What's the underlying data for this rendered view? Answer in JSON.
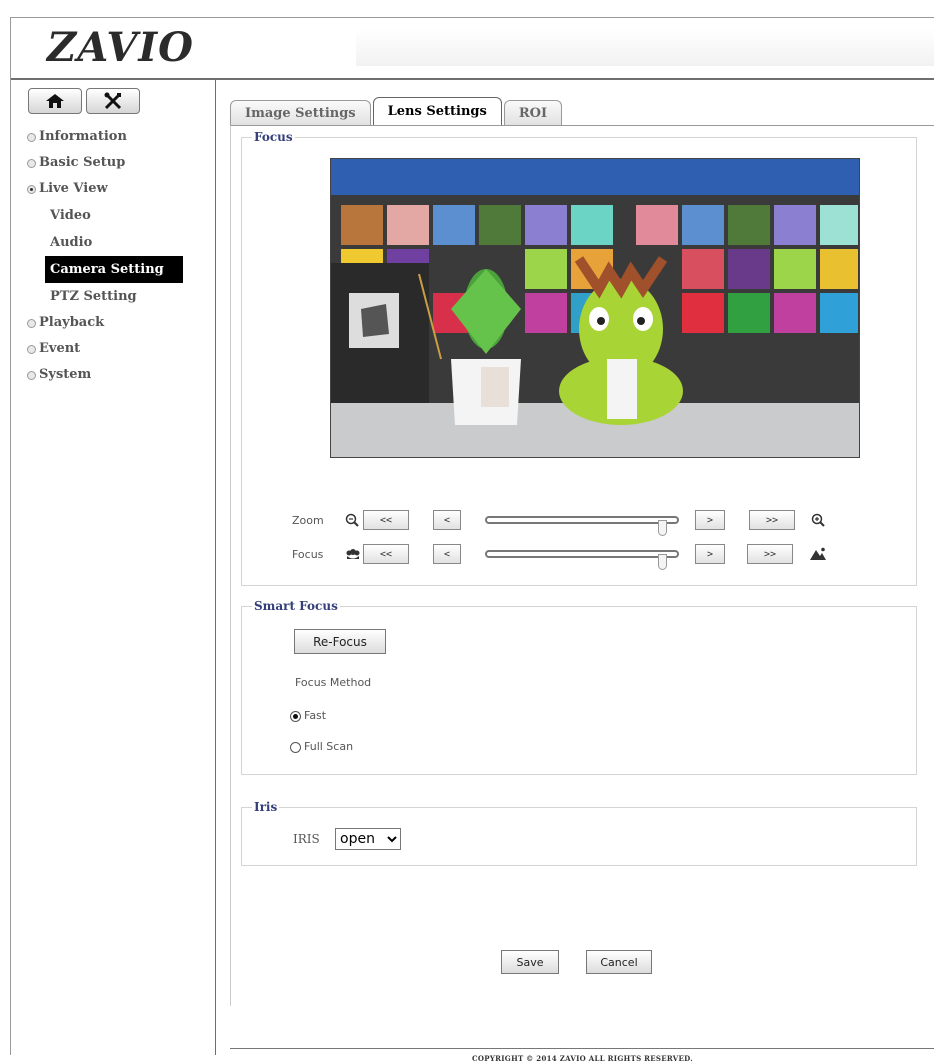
{
  "brand": {
    "logo_text": "ZAVIO"
  },
  "sidebar": {
    "home_icon": "home-icon",
    "tools_icon": "tools-icon",
    "items": [
      {
        "label": "Information",
        "selected": false
      },
      {
        "label": "Basic Setup",
        "selected": false
      },
      {
        "label": "Live View",
        "selected": true
      },
      {
        "label": "Playback",
        "selected": false
      },
      {
        "label": "Event",
        "selected": false
      },
      {
        "label": "System",
        "selected": false
      }
    ],
    "live_view_sub": [
      {
        "label": "Video"
      },
      {
        "label": "Audio"
      },
      {
        "label": "Camera Setting",
        "active": true
      },
      {
        "label": "PTZ Setting"
      }
    ]
  },
  "tabs": [
    {
      "label": "Image Settings",
      "active": false
    },
    {
      "label": "Lens Settings",
      "active": true
    },
    {
      "label": "ROI",
      "active": false
    }
  ],
  "focus_section": {
    "legend": "Focus",
    "zoom": {
      "label": "Zoom",
      "btn_far_left": "<<",
      "btn_left": "<",
      "btn_right": ">",
      "btn_far_right": ">>",
      "level": 0.92,
      "icon_left": "zoom-out-icon",
      "icon_right": "zoom-in-icon"
    },
    "focus": {
      "label": "Focus",
      "btn_far_left": "<<",
      "btn_left": "<",
      "btn_right": ">",
      "btn_far_right": ">>",
      "level": 0.92,
      "icon_left": "flower-macro-icon",
      "icon_right": "mountain-far-icon"
    }
  },
  "smart_focus": {
    "legend": "Smart Focus",
    "refocus_label": "Re-Focus",
    "method_label": "Focus Method",
    "options": [
      {
        "label": "Fast",
        "checked": true
      },
      {
        "label": "Full Scan",
        "checked": false
      }
    ]
  },
  "iris": {
    "legend": "Iris",
    "label": "IRIS",
    "value": "open"
  },
  "actions": {
    "save": "Save",
    "cancel": "Cancel"
  },
  "footer": {
    "copyright": "COPYRIGHT © 2014 ZAVIO ALL RIGHTS RESERVED."
  }
}
